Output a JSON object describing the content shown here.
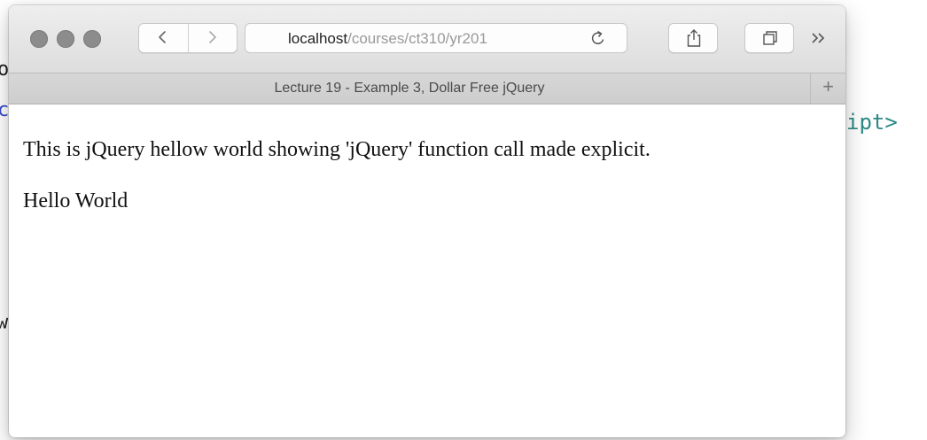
{
  "browser": {
    "address": {
      "host": "localhost",
      "path": "/courses/ct310/yr201"
    },
    "tab": {
      "title": "Lecture 19 - Example 3, Dollar Free jQuery",
      "new_tab_label": "+"
    },
    "more_label": "»",
    "icons": {
      "window_controls": [
        "close-dot",
        "minimize-dot",
        "zoom-dot"
      ],
      "back": "chevron-left-icon",
      "forward": "chevron-right-icon",
      "reload": "reload-icon",
      "share": "share-icon",
      "tabs": "tabs-overview-icon",
      "more": "chevron-double-right-icon"
    }
  },
  "page": {
    "paragraphs": [
      "This is jQuery hellow world showing 'jQuery' function call made explicit.",
      "Hello World"
    ]
  },
  "background": {
    "fragments": [
      "ipt>",
      "o",
      "c",
      "w"
    ]
  },
  "colors": {
    "toolbar": "#e4e4e4",
    "tabbar": "#d3d3d3",
    "traffic_light": "#8c8c8c",
    "code_teal": "#2b8a86",
    "code_blue": "#3a4ccf"
  }
}
